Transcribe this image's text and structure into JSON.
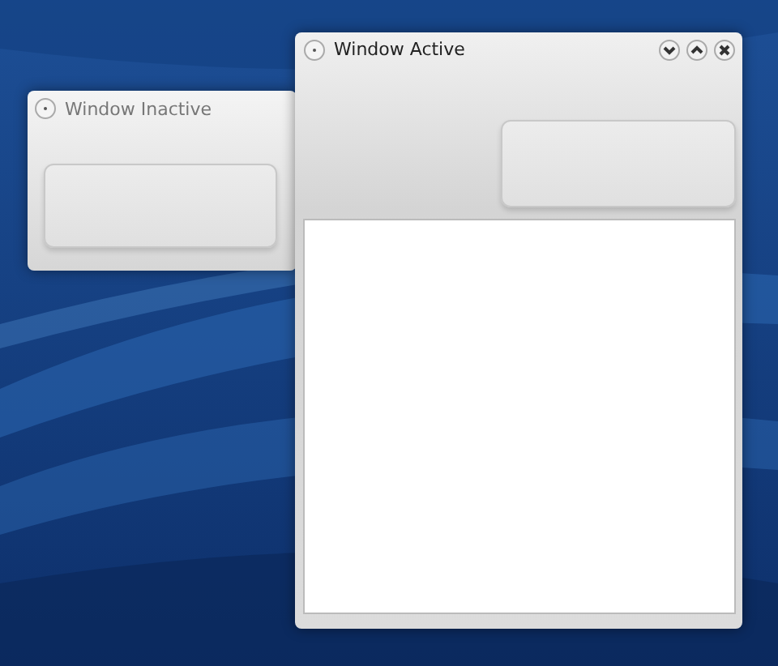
{
  "windows": [
    {
      "title": "Window Inactive",
      "active": false
    },
    {
      "title": "Window Active",
      "active": true
    }
  ]
}
